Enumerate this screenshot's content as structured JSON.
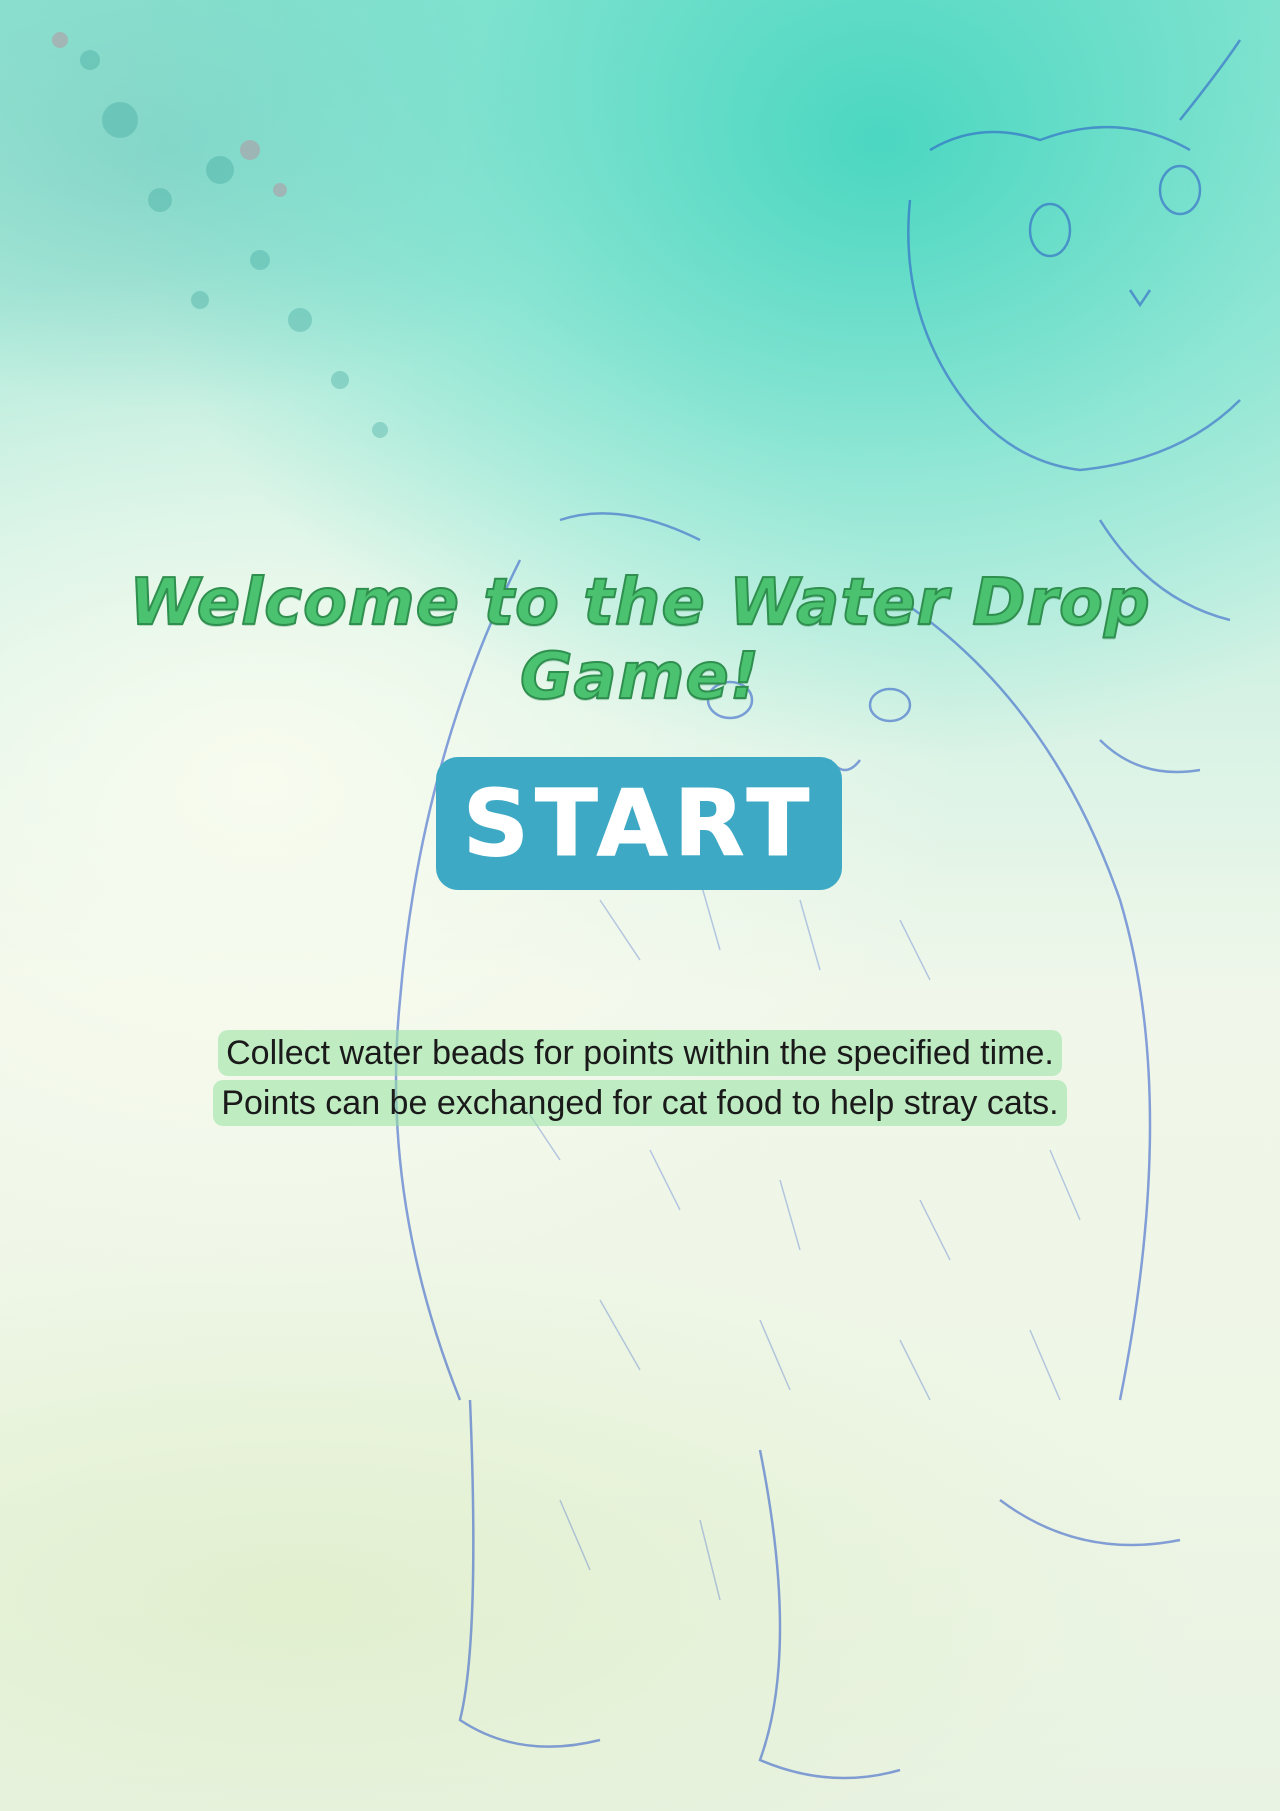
{
  "game": {
    "title": "Welcome to the Water Drop Game!",
    "start_label": "START",
    "description": [
      "Collect water beads for points within the specified time.",
      "Points can be exchanged for cat food to help stray cats."
    ]
  },
  "colors": {
    "title_fill": "#4bc26f",
    "title_stroke": "#2f8f4f",
    "button_bg": "#3da9c5",
    "button_text": "#ffffff",
    "text_highlight": "#96e1a0",
    "sketch_ink": "#2a56c8"
  },
  "icons": {
    "background": "cat-sketch-illustration"
  }
}
